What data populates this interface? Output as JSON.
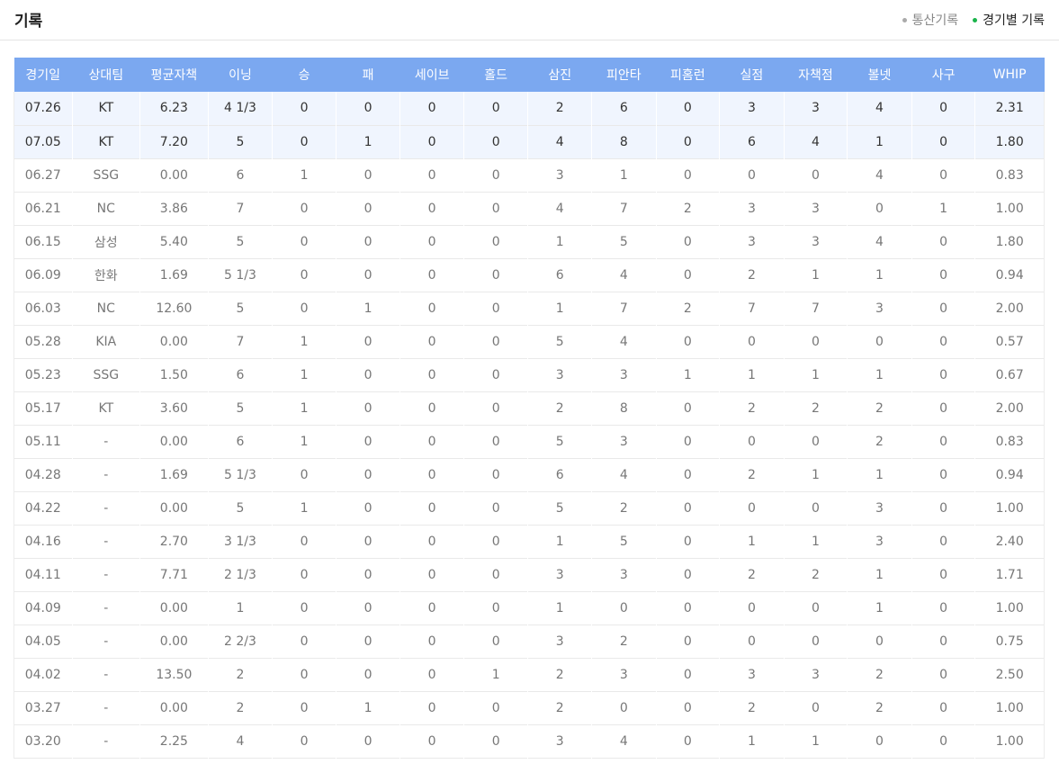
{
  "header": {
    "title": "기록",
    "tabs": [
      {
        "label": "통산기록",
        "active": false
      },
      {
        "label": "경기별 기록",
        "active": true
      }
    ]
  },
  "colors": {
    "header_bg": "#7ba8f0",
    "highlight_row": "#f0f5fe",
    "active_dot": "#19b34a"
  },
  "table": {
    "columns": [
      "경기일",
      "상대팀",
      "평균자책",
      "이닝",
      "승",
      "패",
      "세이브",
      "홀드",
      "삼진",
      "피안타",
      "피홈런",
      "실점",
      "자책점",
      "볼넷",
      "사구",
      "WHIP"
    ],
    "rows": [
      {
        "highlight": true,
        "cells": [
          "07.26",
          "KT",
          "6.23",
          "4 1/3",
          "0",
          "0",
          "0",
          "0",
          "2",
          "6",
          "0",
          "3",
          "3",
          "4",
          "0",
          "2.31"
        ]
      },
      {
        "highlight": true,
        "cells": [
          "07.05",
          "KT",
          "7.20",
          "5",
          "0",
          "1",
          "0",
          "0",
          "4",
          "8",
          "0",
          "6",
          "4",
          "1",
          "0",
          "1.80"
        ]
      },
      {
        "highlight": false,
        "cells": [
          "06.27",
          "SSG",
          "0.00",
          "6",
          "1",
          "0",
          "0",
          "0",
          "3",
          "1",
          "0",
          "0",
          "0",
          "4",
          "0",
          "0.83"
        ]
      },
      {
        "highlight": false,
        "cells": [
          "06.21",
          "NC",
          "3.86",
          "7",
          "0",
          "0",
          "0",
          "0",
          "4",
          "7",
          "2",
          "3",
          "3",
          "0",
          "1",
          "1.00"
        ]
      },
      {
        "highlight": false,
        "cells": [
          "06.15",
          "삼성",
          "5.40",
          "5",
          "0",
          "0",
          "0",
          "0",
          "1",
          "5",
          "0",
          "3",
          "3",
          "4",
          "0",
          "1.80"
        ]
      },
      {
        "highlight": false,
        "cells": [
          "06.09",
          "한화",
          "1.69",
          "5 1/3",
          "0",
          "0",
          "0",
          "0",
          "6",
          "4",
          "0",
          "2",
          "1",
          "1",
          "0",
          "0.94"
        ]
      },
      {
        "highlight": false,
        "cells": [
          "06.03",
          "NC",
          "12.60",
          "5",
          "0",
          "1",
          "0",
          "0",
          "1",
          "7",
          "2",
          "7",
          "7",
          "3",
          "0",
          "2.00"
        ]
      },
      {
        "highlight": false,
        "cells": [
          "05.28",
          "KIA",
          "0.00",
          "7",
          "1",
          "0",
          "0",
          "0",
          "5",
          "4",
          "0",
          "0",
          "0",
          "0",
          "0",
          "0.57"
        ]
      },
      {
        "highlight": false,
        "cells": [
          "05.23",
          "SSG",
          "1.50",
          "6",
          "1",
          "0",
          "0",
          "0",
          "3",
          "3",
          "1",
          "1",
          "1",
          "1",
          "0",
          "0.67"
        ]
      },
      {
        "highlight": false,
        "cells": [
          "05.17",
          "KT",
          "3.60",
          "5",
          "1",
          "0",
          "0",
          "0",
          "2",
          "8",
          "0",
          "2",
          "2",
          "2",
          "0",
          "2.00"
        ]
      },
      {
        "highlight": false,
        "cells": [
          "05.11",
          "-",
          "0.00",
          "6",
          "1",
          "0",
          "0",
          "0",
          "5",
          "3",
          "0",
          "0",
          "0",
          "2",
          "0",
          "0.83"
        ]
      },
      {
        "highlight": false,
        "cells": [
          "04.28",
          "-",
          "1.69",
          "5 1/3",
          "0",
          "0",
          "0",
          "0",
          "6",
          "4",
          "0",
          "2",
          "1",
          "1",
          "0",
          "0.94"
        ]
      },
      {
        "highlight": false,
        "cells": [
          "04.22",
          "-",
          "0.00",
          "5",
          "1",
          "0",
          "0",
          "0",
          "5",
          "2",
          "0",
          "0",
          "0",
          "3",
          "0",
          "1.00"
        ]
      },
      {
        "highlight": false,
        "cells": [
          "04.16",
          "-",
          "2.70",
          "3 1/3",
          "0",
          "0",
          "0",
          "0",
          "1",
          "5",
          "0",
          "1",
          "1",
          "3",
          "0",
          "2.40"
        ]
      },
      {
        "highlight": false,
        "cells": [
          "04.11",
          "-",
          "7.71",
          "2 1/3",
          "0",
          "0",
          "0",
          "0",
          "3",
          "3",
          "0",
          "2",
          "2",
          "1",
          "0",
          "1.71"
        ]
      },
      {
        "highlight": false,
        "cells": [
          "04.09",
          "-",
          "0.00",
          "1",
          "0",
          "0",
          "0",
          "0",
          "1",
          "0",
          "0",
          "0",
          "0",
          "1",
          "0",
          "1.00"
        ]
      },
      {
        "highlight": false,
        "cells": [
          "04.05",
          "-",
          "0.00",
          "2 2/3",
          "0",
          "0",
          "0",
          "0",
          "3",
          "2",
          "0",
          "0",
          "0",
          "0",
          "0",
          "0.75"
        ]
      },
      {
        "highlight": false,
        "cells": [
          "04.02",
          "-",
          "13.50",
          "2",
          "0",
          "0",
          "0",
          "1",
          "2",
          "3",
          "0",
          "3",
          "3",
          "2",
          "0",
          "2.50"
        ]
      },
      {
        "highlight": false,
        "cells": [
          "03.27",
          "-",
          "0.00",
          "2",
          "0",
          "1",
          "0",
          "0",
          "2",
          "0",
          "0",
          "2",
          "0",
          "2",
          "0",
          "1.00"
        ]
      },
      {
        "highlight": false,
        "cells": [
          "03.20",
          "-",
          "2.25",
          "4",
          "0",
          "0",
          "0",
          "0",
          "3",
          "4",
          "0",
          "1",
          "1",
          "0",
          "0",
          "1.00"
        ]
      }
    ]
  }
}
